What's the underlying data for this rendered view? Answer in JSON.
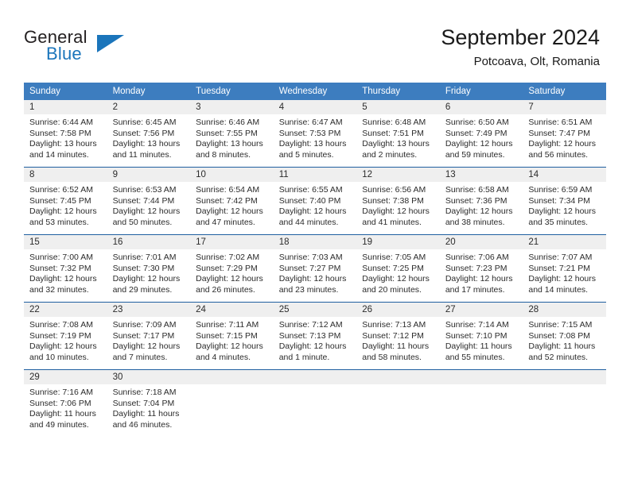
{
  "brand": {
    "name_part1": "General",
    "name_part2": "Blue",
    "flag_icon": "triangle-flag-icon"
  },
  "header": {
    "title": "September 2024",
    "subtitle": "Potcoava, Olt, Romania"
  },
  "calendar": {
    "weekday_headers": [
      "Sunday",
      "Monday",
      "Tuesday",
      "Wednesday",
      "Thursday",
      "Friday",
      "Saturday"
    ],
    "accent_color": "#3d7dbf",
    "separator_color": "#1f5fa0",
    "daynum_bg": "#efefef",
    "weeks": [
      [
        {
          "day": "1",
          "sunrise": "Sunrise: 6:44 AM",
          "sunset": "Sunset: 7:58 PM",
          "daylight_l1": "Daylight: 13 hours",
          "daylight_l2": "and 14 minutes."
        },
        {
          "day": "2",
          "sunrise": "Sunrise: 6:45 AM",
          "sunset": "Sunset: 7:56 PM",
          "daylight_l1": "Daylight: 13 hours",
          "daylight_l2": "and 11 minutes."
        },
        {
          "day": "3",
          "sunrise": "Sunrise: 6:46 AM",
          "sunset": "Sunset: 7:55 PM",
          "daylight_l1": "Daylight: 13 hours",
          "daylight_l2": "and 8 minutes."
        },
        {
          "day": "4",
          "sunrise": "Sunrise: 6:47 AM",
          "sunset": "Sunset: 7:53 PM",
          "daylight_l1": "Daylight: 13 hours",
          "daylight_l2": "and 5 minutes."
        },
        {
          "day": "5",
          "sunrise": "Sunrise: 6:48 AM",
          "sunset": "Sunset: 7:51 PM",
          "daylight_l1": "Daylight: 13 hours",
          "daylight_l2": "and 2 minutes."
        },
        {
          "day": "6",
          "sunrise": "Sunrise: 6:50 AM",
          "sunset": "Sunset: 7:49 PM",
          "daylight_l1": "Daylight: 12 hours",
          "daylight_l2": "and 59 minutes."
        },
        {
          "day": "7",
          "sunrise": "Sunrise: 6:51 AM",
          "sunset": "Sunset: 7:47 PM",
          "daylight_l1": "Daylight: 12 hours",
          "daylight_l2": "and 56 minutes."
        }
      ],
      [
        {
          "day": "8",
          "sunrise": "Sunrise: 6:52 AM",
          "sunset": "Sunset: 7:45 PM",
          "daylight_l1": "Daylight: 12 hours",
          "daylight_l2": "and 53 minutes."
        },
        {
          "day": "9",
          "sunrise": "Sunrise: 6:53 AM",
          "sunset": "Sunset: 7:44 PM",
          "daylight_l1": "Daylight: 12 hours",
          "daylight_l2": "and 50 minutes."
        },
        {
          "day": "10",
          "sunrise": "Sunrise: 6:54 AM",
          "sunset": "Sunset: 7:42 PM",
          "daylight_l1": "Daylight: 12 hours",
          "daylight_l2": "and 47 minutes."
        },
        {
          "day": "11",
          "sunrise": "Sunrise: 6:55 AM",
          "sunset": "Sunset: 7:40 PM",
          "daylight_l1": "Daylight: 12 hours",
          "daylight_l2": "and 44 minutes."
        },
        {
          "day": "12",
          "sunrise": "Sunrise: 6:56 AM",
          "sunset": "Sunset: 7:38 PM",
          "daylight_l1": "Daylight: 12 hours",
          "daylight_l2": "and 41 minutes."
        },
        {
          "day": "13",
          "sunrise": "Sunrise: 6:58 AM",
          "sunset": "Sunset: 7:36 PM",
          "daylight_l1": "Daylight: 12 hours",
          "daylight_l2": "and 38 minutes."
        },
        {
          "day": "14",
          "sunrise": "Sunrise: 6:59 AM",
          "sunset": "Sunset: 7:34 PM",
          "daylight_l1": "Daylight: 12 hours",
          "daylight_l2": "and 35 minutes."
        }
      ],
      [
        {
          "day": "15",
          "sunrise": "Sunrise: 7:00 AM",
          "sunset": "Sunset: 7:32 PM",
          "daylight_l1": "Daylight: 12 hours",
          "daylight_l2": "and 32 minutes."
        },
        {
          "day": "16",
          "sunrise": "Sunrise: 7:01 AM",
          "sunset": "Sunset: 7:30 PM",
          "daylight_l1": "Daylight: 12 hours",
          "daylight_l2": "and 29 minutes."
        },
        {
          "day": "17",
          "sunrise": "Sunrise: 7:02 AM",
          "sunset": "Sunset: 7:29 PM",
          "daylight_l1": "Daylight: 12 hours",
          "daylight_l2": "and 26 minutes."
        },
        {
          "day": "18",
          "sunrise": "Sunrise: 7:03 AM",
          "sunset": "Sunset: 7:27 PM",
          "daylight_l1": "Daylight: 12 hours",
          "daylight_l2": "and 23 minutes."
        },
        {
          "day": "19",
          "sunrise": "Sunrise: 7:05 AM",
          "sunset": "Sunset: 7:25 PM",
          "daylight_l1": "Daylight: 12 hours",
          "daylight_l2": "and 20 minutes."
        },
        {
          "day": "20",
          "sunrise": "Sunrise: 7:06 AM",
          "sunset": "Sunset: 7:23 PM",
          "daylight_l1": "Daylight: 12 hours",
          "daylight_l2": "and 17 minutes."
        },
        {
          "day": "21",
          "sunrise": "Sunrise: 7:07 AM",
          "sunset": "Sunset: 7:21 PM",
          "daylight_l1": "Daylight: 12 hours",
          "daylight_l2": "and 14 minutes."
        }
      ],
      [
        {
          "day": "22",
          "sunrise": "Sunrise: 7:08 AM",
          "sunset": "Sunset: 7:19 PM",
          "daylight_l1": "Daylight: 12 hours",
          "daylight_l2": "and 10 minutes."
        },
        {
          "day": "23",
          "sunrise": "Sunrise: 7:09 AM",
          "sunset": "Sunset: 7:17 PM",
          "daylight_l1": "Daylight: 12 hours",
          "daylight_l2": "and 7 minutes."
        },
        {
          "day": "24",
          "sunrise": "Sunrise: 7:11 AM",
          "sunset": "Sunset: 7:15 PM",
          "daylight_l1": "Daylight: 12 hours",
          "daylight_l2": "and 4 minutes."
        },
        {
          "day": "25",
          "sunrise": "Sunrise: 7:12 AM",
          "sunset": "Sunset: 7:13 PM",
          "daylight_l1": "Daylight: 12 hours",
          "daylight_l2": "and 1 minute."
        },
        {
          "day": "26",
          "sunrise": "Sunrise: 7:13 AM",
          "sunset": "Sunset: 7:12 PM",
          "daylight_l1": "Daylight: 11 hours",
          "daylight_l2": "and 58 minutes."
        },
        {
          "day": "27",
          "sunrise": "Sunrise: 7:14 AM",
          "sunset": "Sunset: 7:10 PM",
          "daylight_l1": "Daylight: 11 hours",
          "daylight_l2": "and 55 minutes."
        },
        {
          "day": "28",
          "sunrise": "Sunrise: 7:15 AM",
          "sunset": "Sunset: 7:08 PM",
          "daylight_l1": "Daylight: 11 hours",
          "daylight_l2": "and 52 minutes."
        }
      ],
      [
        {
          "day": "29",
          "sunrise": "Sunrise: 7:16 AM",
          "sunset": "Sunset: 7:06 PM",
          "daylight_l1": "Daylight: 11 hours",
          "daylight_l2": "and 49 minutes."
        },
        {
          "day": "30",
          "sunrise": "Sunrise: 7:18 AM",
          "sunset": "Sunset: 7:04 PM",
          "daylight_l1": "Daylight: 11 hours",
          "daylight_l2": "and 46 minutes."
        },
        {
          "day": "",
          "sunrise": "",
          "sunset": "",
          "daylight_l1": "",
          "daylight_l2": ""
        },
        {
          "day": "",
          "sunrise": "",
          "sunset": "",
          "daylight_l1": "",
          "daylight_l2": ""
        },
        {
          "day": "",
          "sunrise": "",
          "sunset": "",
          "daylight_l1": "",
          "daylight_l2": ""
        },
        {
          "day": "",
          "sunrise": "",
          "sunset": "",
          "daylight_l1": "",
          "daylight_l2": ""
        },
        {
          "day": "",
          "sunrise": "",
          "sunset": "",
          "daylight_l1": "",
          "daylight_l2": ""
        }
      ]
    ]
  }
}
